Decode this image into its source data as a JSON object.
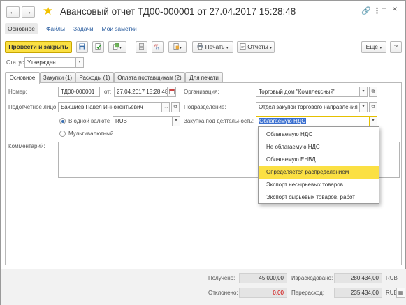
{
  "window": {
    "title": "Авансовый отчет ТД00-000001 от 27.04.2017 15:28:48",
    "back_icon": "←",
    "forward_icon": "→",
    "star_icon": "★",
    "link_icon": "🔗",
    "more_icon": "⋮",
    "max_icon": "□",
    "close_icon": "×"
  },
  "nav": {
    "main": "Основное",
    "files": "Файлы",
    "tasks": "Задачи",
    "notes": "Мои заметки"
  },
  "toolbar": {
    "post_close": "Провести и закрыть",
    "print": "Печать",
    "reports": "Отчеты",
    "more": "Еще",
    "help": "?",
    "dropdown_arrow": "▾"
  },
  "status": {
    "label": "Статус:",
    "value": "Утвержден"
  },
  "tabs": [
    {
      "label": "Основное"
    },
    {
      "label": "Закупки (1)"
    },
    {
      "label": "Расходы (1)"
    },
    {
      "label": "Оплата поставщикам (2)"
    },
    {
      "label": "Для печати"
    }
  ],
  "form": {
    "number_label": "Номер:",
    "number_value": "ТД00-000001",
    "date_label": "от:",
    "date_value": "27.04.2017 15:28:48",
    "org_label": "Организация:",
    "org_value": "Торговый дом \"Комплексный\"",
    "person_label": "Подотчетное лицо:",
    "person_value": "Бахшиев Павел Иннокентьевич",
    "dept_label": "Подразделение:",
    "dept_value": "Отдел закупок торгового направления",
    "single_currency_label": "В одной валюте",
    "currency_value": "RUB",
    "multi_currency_label": "Мультивалютный",
    "purchase_label": "Закупка под деятельность:",
    "purchase_value": "Облагаемую НДС",
    "comment_label": "Комментарий:"
  },
  "purchase_options": [
    {
      "label": "Облагаемую НДС",
      "highlighted": false
    },
    {
      "label": "Не облагаемую НДС",
      "highlighted": false
    },
    {
      "label": "Облагаемую ЕНВД",
      "highlighted": false
    },
    {
      "label": "Определяется распределением",
      "highlighted": true
    },
    {
      "label": "Экспорт несырьевых товаров",
      "highlighted": false
    },
    {
      "label": "Экспорт сырьевых товаров, работ",
      "highlighted": false
    }
  ],
  "totals": {
    "received_label": "Получено:",
    "received_value": "45 000,00",
    "spent_label": "Израсходовано:",
    "spent_value": "280 434,00",
    "rejected_label": "Отклонено:",
    "rejected_value": "0,00",
    "overspent_label": "Перерасход:",
    "overspent_value": "235 434,00",
    "currency": "RUB"
  },
  "colors": {
    "accent_yellow": "#fbe043",
    "link_blue": "#2a5d9f",
    "negative_red": "#d20000"
  }
}
